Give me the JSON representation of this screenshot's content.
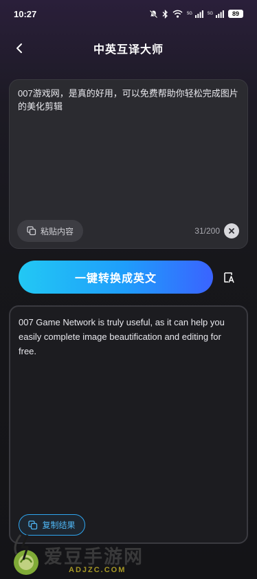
{
  "status_bar": {
    "time": "10:27",
    "network_1": "5G",
    "network_2": "5G",
    "battery": "89"
  },
  "header": {
    "title": "中英互译大师"
  },
  "input_card": {
    "text": "007游戏网，是真的好用，可以免费帮助你轻松完成图片的美化剪辑",
    "paste_label": "粘贴内容",
    "char_count": "31/200"
  },
  "convert_button": {
    "label": "一键转换成英文"
  },
  "output_card": {
    "text": "007 Game Network is truly useful, as it can help you easily complete image beautification and editing for free.",
    "copy_label": "复制结果"
  },
  "watermark": {
    "title": "爱豆手游网",
    "domain": "ADJZC.COM"
  },
  "colors": {
    "accent_start": "#22c8f4",
    "accent_end": "#3a63ff",
    "copy_accent": "#4fb6f4"
  }
}
